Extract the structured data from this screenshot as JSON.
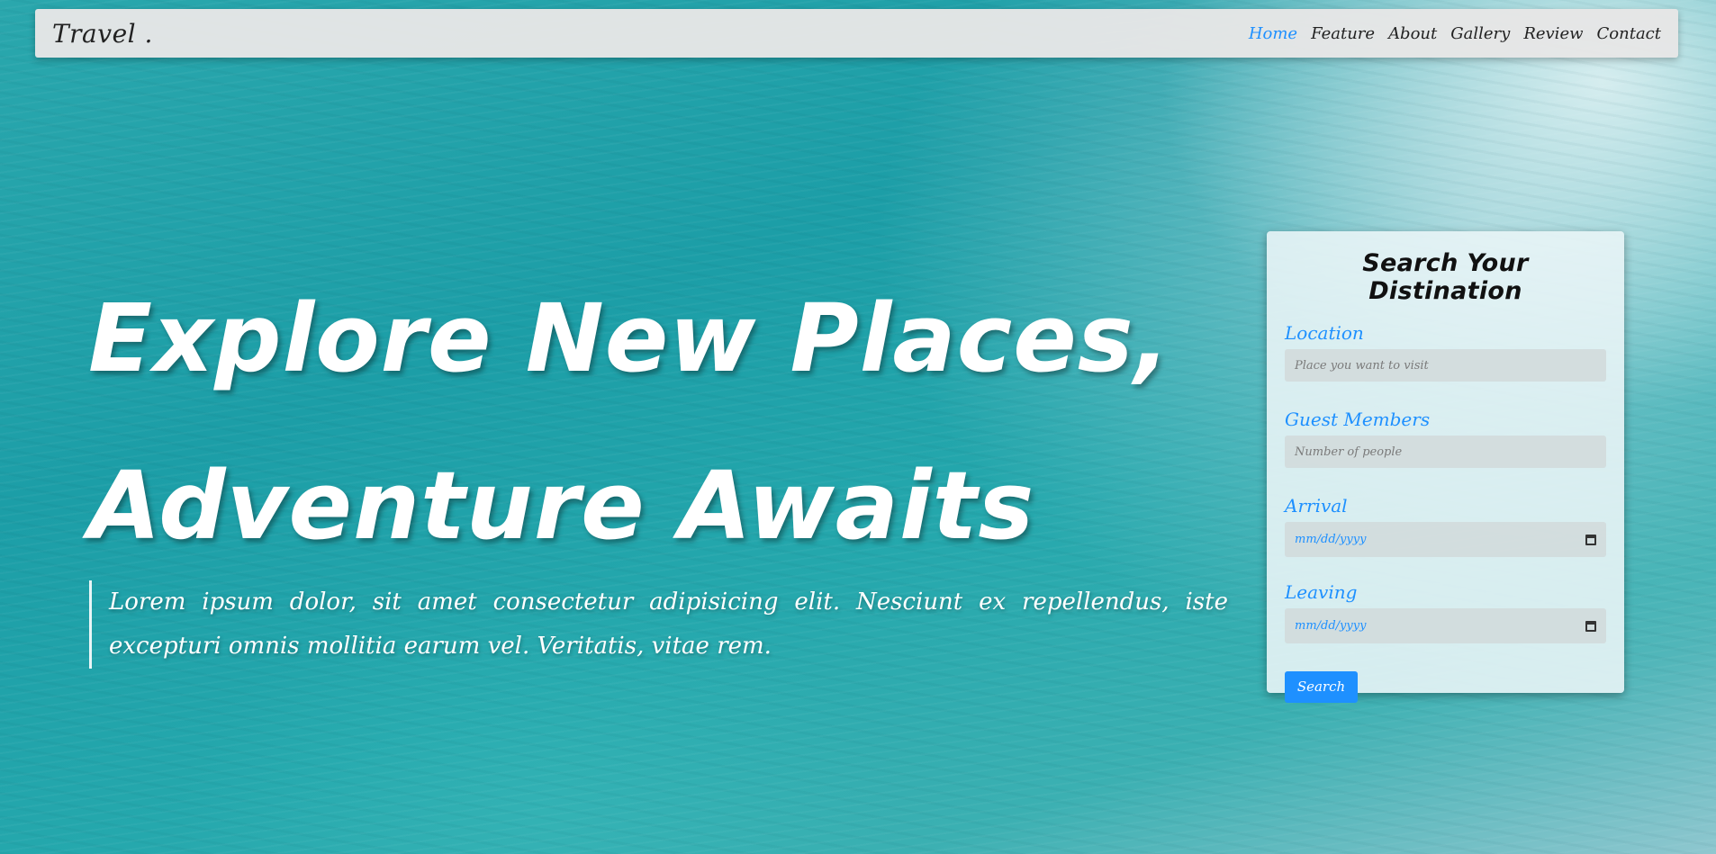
{
  "navbar": {
    "brand": "Travel .",
    "links": [
      {
        "label": "Home",
        "active": true
      },
      {
        "label": "Feature"
      },
      {
        "label": "About"
      },
      {
        "label": "Gallery"
      },
      {
        "label": "Review"
      },
      {
        "label": "Contact"
      }
    ]
  },
  "hero": {
    "title_line1": "Explore New Places,",
    "title_line2": "Adventure Awaits",
    "text": "Lorem ipsum dolor, sit amet consectetur adipisicing elit. Nesciunt ex repellendus, iste excepturi omnis mollitia earum vel. Veritatis, vitae rem."
  },
  "search_form": {
    "title": "Search Your Distination",
    "location": {
      "label": "Location",
      "placeholder": "Place you want to visit"
    },
    "guests": {
      "label": "Guest Members",
      "placeholder": "Number of people"
    },
    "arrival": {
      "label": "Arrival",
      "value": "mm/dd/yyyy",
      "icon": "calendar-icon"
    },
    "leaving": {
      "label": "Leaving",
      "value": "mm/dd/yyyy",
      "icon": "calendar-icon"
    },
    "button_label": "Search"
  },
  "colors": {
    "accent": "#1e90ff",
    "navbar_bg": "#e6e6e6",
    "sea": "#1fa0a8"
  }
}
